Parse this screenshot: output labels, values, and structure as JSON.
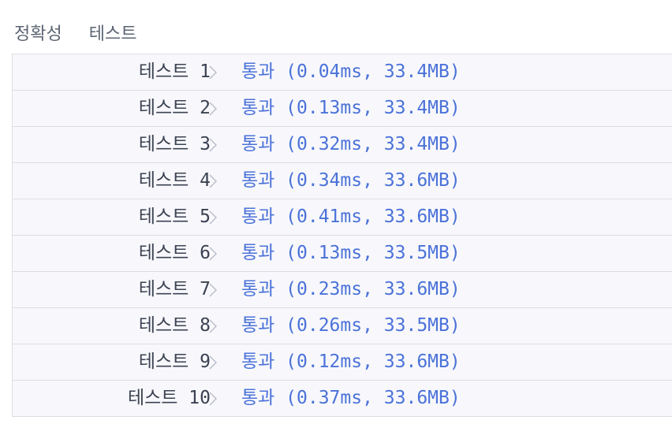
{
  "header": {
    "title": "정확성",
    "subtitle": "테스트"
  },
  "tests": [
    {
      "name": "테스트 1",
      "result": "통과 (0.04ms, 33.4MB)"
    },
    {
      "name": "테스트 2",
      "result": "통과 (0.13ms, 33.4MB)"
    },
    {
      "name": "테스트 3",
      "result": "통과 (0.32ms, 33.4MB)"
    },
    {
      "name": "테스트 4",
      "result": "통과 (0.34ms, 33.6MB)"
    },
    {
      "name": "테스트 5",
      "result": "통과 (0.41ms, 33.6MB)"
    },
    {
      "name": "테스트 6",
      "result": "통과 (0.13ms, 33.5MB)"
    },
    {
      "name": "테스트 7",
      "result": "통과 (0.23ms, 33.6MB)"
    },
    {
      "name": "테스트 8",
      "result": "통과 (0.26ms, 33.5MB)"
    },
    {
      "name": "테스트 9",
      "result": "통과 (0.12ms, 33.6MB)"
    },
    {
      "name": "테스트 10",
      "result": "통과 (0.37ms, 33.6MB)"
    }
  ],
  "icons": {
    "row_expand": "chevron-right-icon"
  },
  "colors": {
    "pass_text": "#4b72d9",
    "label_text": "#3b4252",
    "row_background": "#f8f8fc",
    "border": "#dcdde3"
  }
}
